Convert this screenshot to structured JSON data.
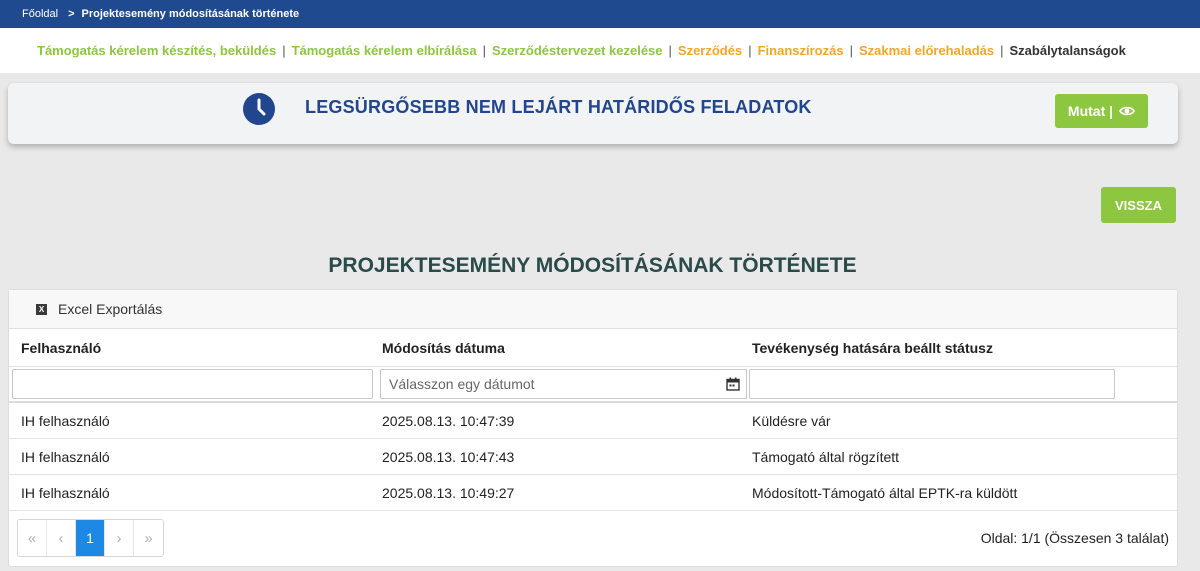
{
  "breadcrumb": {
    "home": "Főoldal",
    "separator": ">",
    "current": "Projektesemény módosításának története"
  },
  "nav": {
    "items": [
      {
        "label": "Támogatás kérelem készítés, beküldés",
        "color": "#8dc63f"
      },
      {
        "label": "Támogatás kérelem elbírálása",
        "color": "#8dc63f"
      },
      {
        "label": "Szerződéstervezet kezelése",
        "color": "#8dc63f"
      },
      {
        "label": "Szerződés",
        "color": "#f5a623"
      },
      {
        "label": "Finanszírozás",
        "color": "#f5a623"
      },
      {
        "label": "Szakmai előrehaladás",
        "color": "#f5a623"
      },
      {
        "label": "Szabálytalanságok",
        "color": "#333333"
      }
    ],
    "divider": "|"
  },
  "deadline_panel": {
    "title": "LEGSÜRGŐSEBB NEM LEJÁRT HATÁRIDŐS FELADATOK",
    "button_label": "Mutat |",
    "icon": "clock-icon",
    "button_icon": "eye-icon"
  },
  "back_button_label": "VISSZA",
  "page_title": "PROJEKTESEMÉNY MÓDOSÍTÁSÁNAK TÖRTÉNETE",
  "grid": {
    "export_label": "Excel Exportálás",
    "columns": [
      "Felhasználó",
      "Módosítás dátuma",
      "Tevékenység hatására beállt státusz"
    ],
    "date_filter_placeholder": "Válasszon egy dátumot",
    "rows": [
      [
        "IH felhasználó",
        "2025.08.13. 10:47:39",
        "Küldésre vár"
      ],
      [
        "IH felhasználó",
        "2025.08.13. 10:47:43",
        "Támogató által rögzített"
      ],
      [
        "IH felhasználó",
        "2025.08.13. 10:49:27",
        "Módosított-Támogató által EPTK-ra küldött"
      ]
    ],
    "pager": {
      "first": "«",
      "prev": "‹",
      "current_page": "1",
      "next": "›",
      "last": "»",
      "info": "Oldal: 1/1 (Összesen 3 találat)"
    }
  },
  "colors": {
    "header_blue": "#1f4a8f",
    "accent_green": "#8dc63f",
    "nav_orange": "#f5a623",
    "title_blue": "#22468e",
    "pager_active": "#1e88e5"
  }
}
